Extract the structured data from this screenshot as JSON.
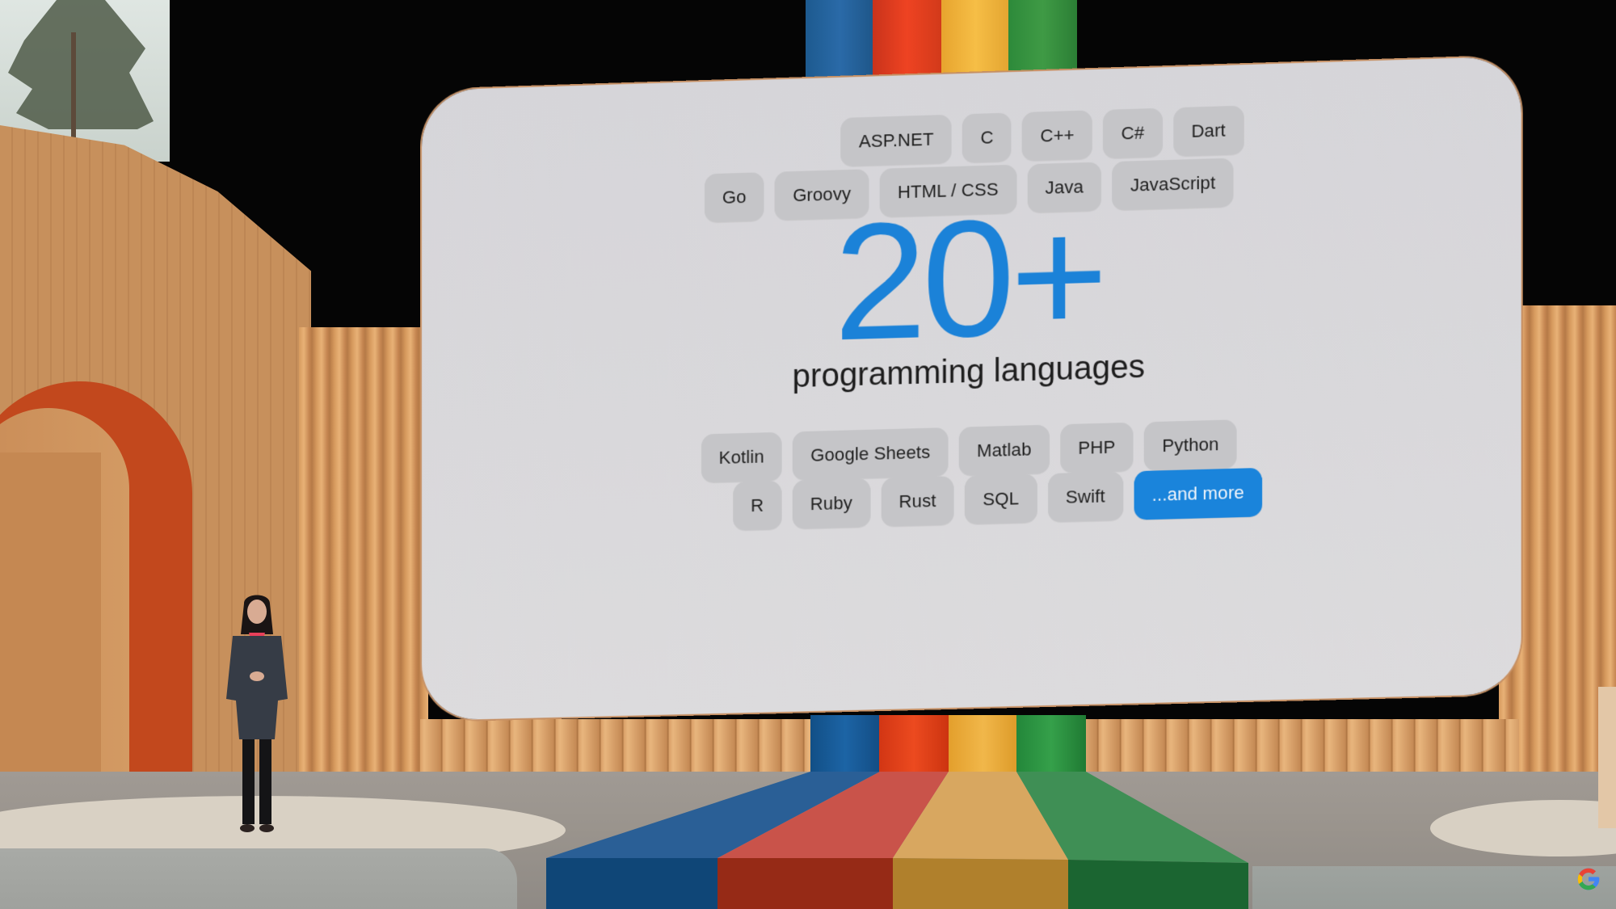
{
  "slide": {
    "headline_number": "20+",
    "headline_subtitle": "programming languages",
    "accent_color": "#1a84db",
    "chip_color": "#c5c5c8",
    "chip_rows_top": [
      [
        "ASP.NET",
        "C",
        "C++",
        "C#",
        "Dart"
      ],
      [
        "Go",
        "Groovy",
        "HTML / CSS",
        "Java",
        "JavaScript"
      ]
    ],
    "chip_rows_bottom": [
      [
        "Kotlin",
        "Google Sheets",
        "Matlab",
        "PHP",
        "Python"
      ],
      [
        "R",
        "Ruby",
        "Rust",
        "SQL",
        "Swift"
      ]
    ],
    "highlight_chip": "...and more"
  },
  "stage": {
    "pillar_colors": [
      "#2a6aa8",
      "#ee4322",
      "#f6be46",
      "#3f9a45"
    ],
    "ramp_colors": [
      "#2a5f96",
      "#c9534a",
      "#d8a760",
      "#3f8f55"
    ],
    "ramp_front_colors": [
      "#0f4677",
      "#962a16",
      "#b0802c",
      "#1b6531"
    ],
    "arch_color": "#c2481d"
  },
  "watermark": {
    "icon": "google-g-icon",
    "colors": [
      "#ea4335",
      "#fbbc05",
      "#34a853",
      "#4285f4"
    ]
  }
}
